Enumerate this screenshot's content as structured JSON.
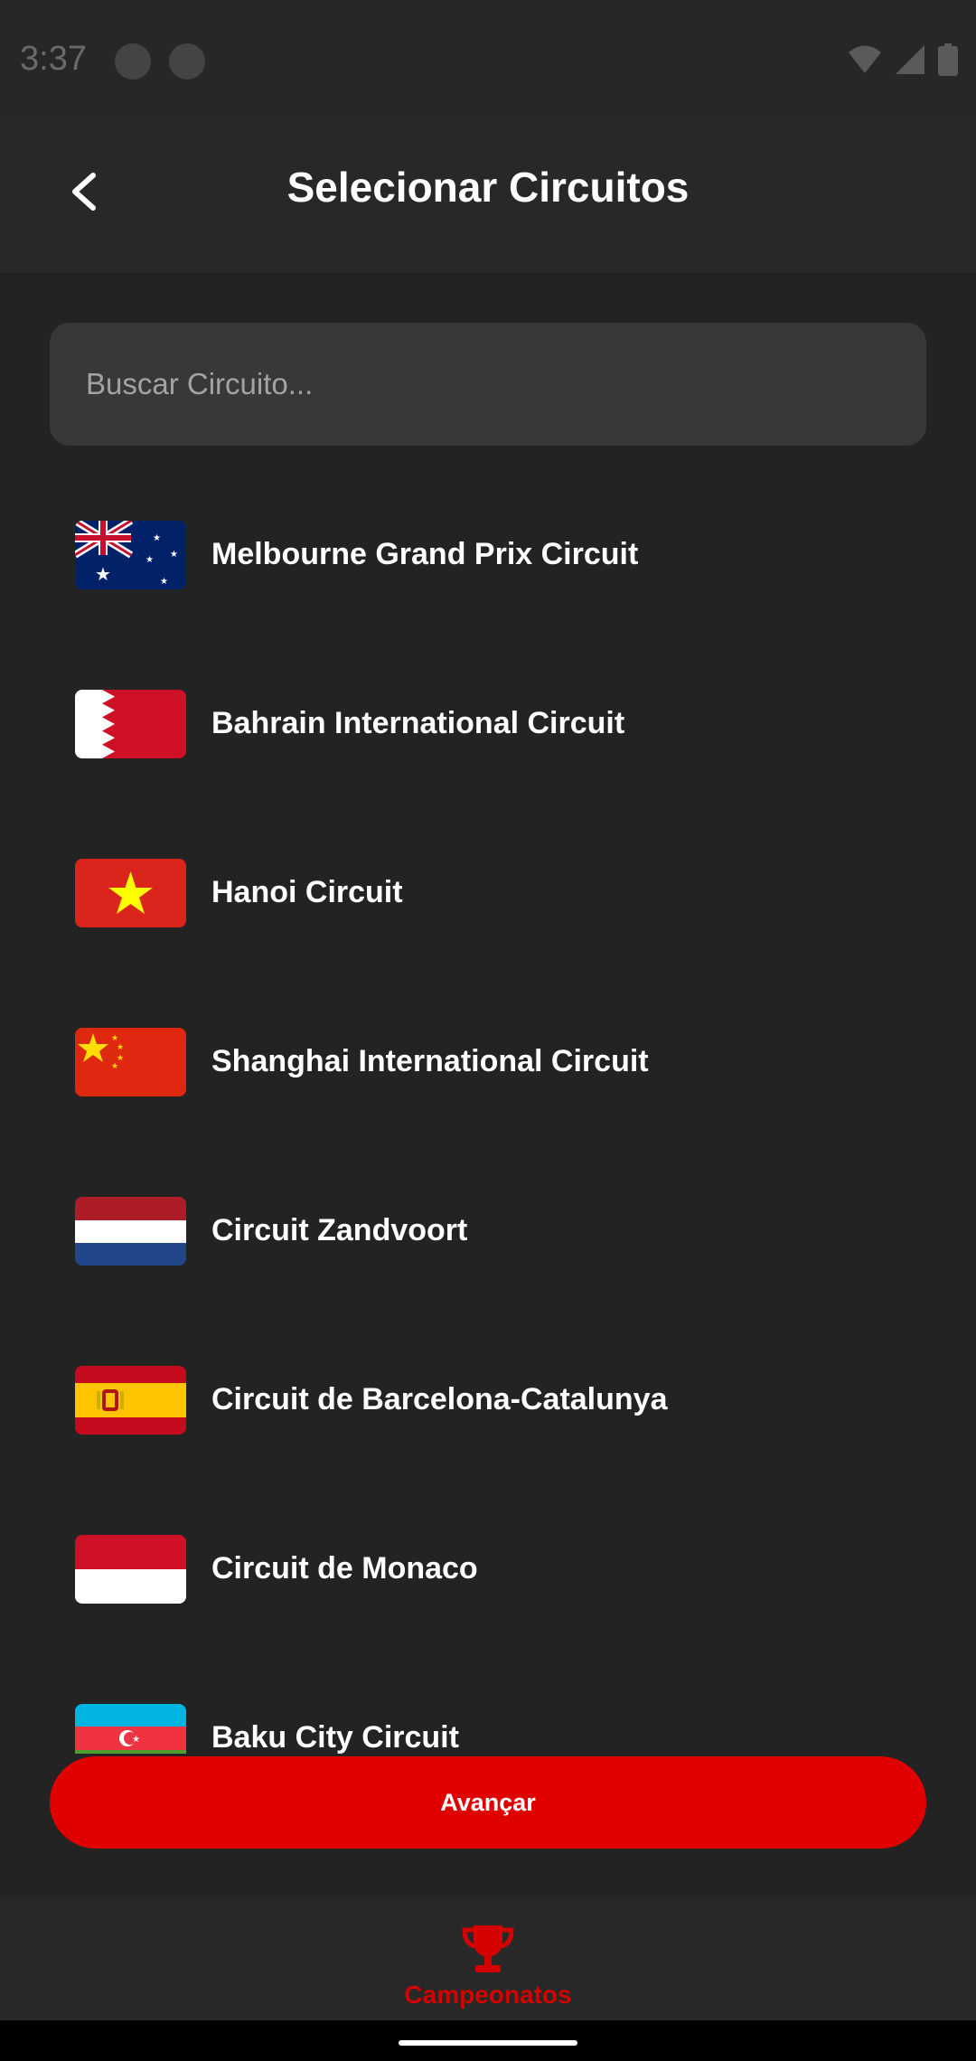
{
  "status_bar": {
    "time": "3:37",
    "icons": [
      "app-icon",
      "app-icon-2",
      "wifi-icon",
      "signal-icon",
      "battery-icon"
    ]
  },
  "header": {
    "title": "Selecionar Circuitos",
    "back_icon": "chevron-left-icon"
  },
  "search": {
    "placeholder": "Buscar Circuito...",
    "value": ""
  },
  "circuits": [
    {
      "name": "Melbourne Grand Prix Circuit",
      "flag": "australia"
    },
    {
      "name": "Bahrain International Circuit",
      "flag": "bahrain"
    },
    {
      "name": "Hanoi Circuit",
      "flag": "vietnam"
    },
    {
      "name": "Shanghai International Circuit",
      "flag": "china"
    },
    {
      "name": "Circuit Zandvoort",
      "flag": "netherlands"
    },
    {
      "name": "Circuit de Barcelona-Catalunya",
      "flag": "spain"
    },
    {
      "name": "Circuit de Monaco",
      "flag": "monaco"
    },
    {
      "name": "Baku City Circuit",
      "flag": "azerbaijan"
    }
  ],
  "actions": {
    "advance_label": "Avançar"
  },
  "bottom_nav": {
    "items": [
      {
        "label": "Campeonatos",
        "icon": "trophy-icon",
        "active": true
      }
    ]
  },
  "colors": {
    "accent": "#e00000",
    "background": "#232323",
    "surface": "#383838"
  }
}
